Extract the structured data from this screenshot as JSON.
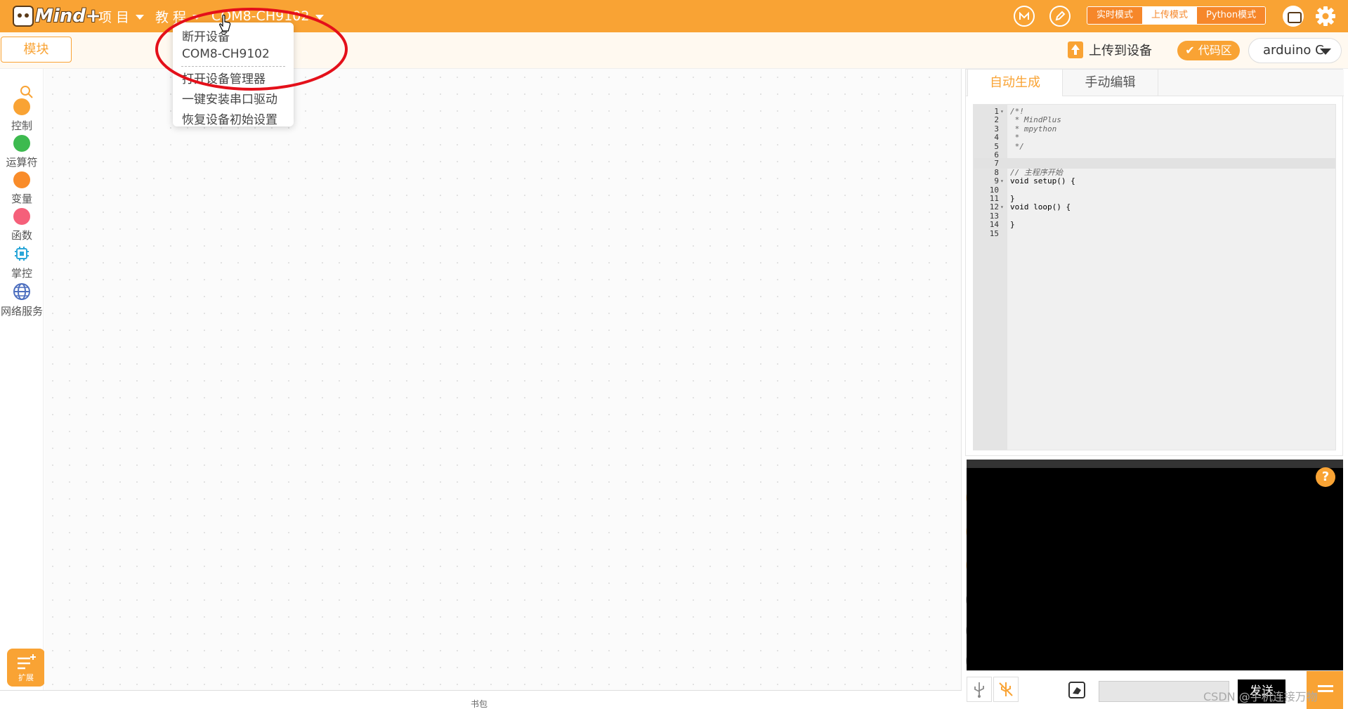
{
  "app": {
    "logo_text": "Mind+",
    "menus": {
      "project": "项 目",
      "tutorial": "教 程",
      "device": "COM8-CH9102"
    },
    "modes": [
      "实时模式",
      "上传模式",
      "Python模式"
    ],
    "active_mode": "上传模式"
  },
  "toolbar": {
    "blocks_tab": "模块",
    "upload_button": "上传到设备",
    "code_area_button": "代码区",
    "board_select": "arduino C"
  },
  "sidebar": {
    "categories": [
      {
        "label": "控制",
        "color": "#f9a334",
        "icon": "circle"
      },
      {
        "label": "运算符",
        "color": "#3dba4f",
        "icon": "circle"
      },
      {
        "label": "变量",
        "color": "#f98c2a",
        "icon": "circle"
      },
      {
        "label": "函数",
        "color": "#f5607a",
        "icon": "circle"
      },
      {
        "label": "掌控",
        "color": "#2aa6d8",
        "icon": "chip-icon"
      },
      {
        "label": "网络服务",
        "color": "#4d6fbf",
        "icon": "globe-icon"
      }
    ],
    "extension_label": "扩展"
  },
  "dropdown": {
    "items": [
      "断开设备",
      "COM8-CH9102",
      "打开设备管理器",
      "一键安装串口驱动",
      "恢复设备初始设置"
    ]
  },
  "code_panel": {
    "tabs": [
      "自动生成",
      "手动编辑"
    ],
    "active_tab": "自动生成",
    "lines": [
      {
        "n": "1",
        "fold": true,
        "text": "/*!",
        "comment": true
      },
      {
        "n": "2",
        "fold": false,
        "text": " * MindPlus",
        "comment": true
      },
      {
        "n": "3",
        "fold": false,
        "text": " * mpython",
        "comment": true
      },
      {
        "n": "4",
        "fold": false,
        "text": " *",
        "comment": true
      },
      {
        "n": "5",
        "fold": false,
        "text": " */",
        "comment": true
      },
      {
        "n": "6",
        "fold": false,
        "text": "",
        "comment": false
      },
      {
        "n": "7",
        "fold": false,
        "text": "",
        "comment": false,
        "current": true
      },
      {
        "n": "8",
        "fold": false,
        "text": "// 主程序开始",
        "comment": true
      },
      {
        "n": "9",
        "fold": true,
        "text": "void setup() {",
        "comment": false
      },
      {
        "n": "10",
        "fold": false,
        "text": "",
        "comment": false
      },
      {
        "n": "11",
        "fold": false,
        "text": "}",
        "comment": false
      },
      {
        "n": "12",
        "fold": true,
        "text": "void loop() {",
        "comment": false
      },
      {
        "n": "13",
        "fold": false,
        "text": "",
        "comment": false
      },
      {
        "n": "14",
        "fold": false,
        "text": "}",
        "comment": false
      },
      {
        "n": "15",
        "fold": false,
        "text": "",
        "comment": false
      }
    ]
  },
  "serial": {
    "help": "?",
    "send_button": "发送",
    "input_value": ""
  },
  "footer": {
    "bookbag_label": "书包"
  },
  "watermark": "CSDN @手机连接万物",
  "colors": {
    "accent": "#f9a334",
    "mode_bg": "#f6872a",
    "highlight_ellipse": "#e4101a"
  }
}
